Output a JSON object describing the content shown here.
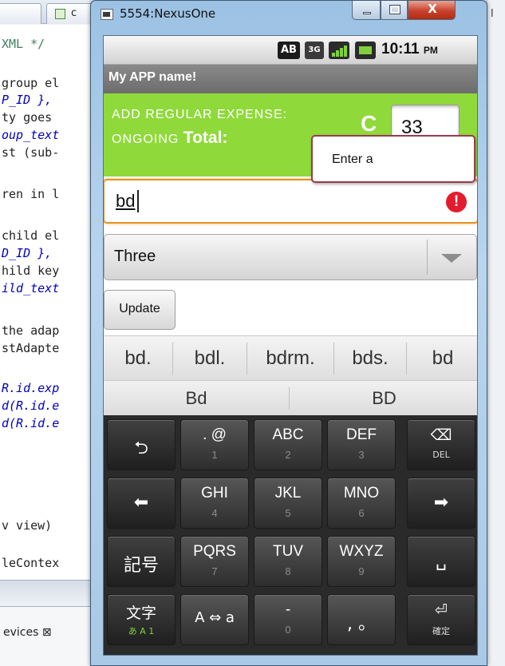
{
  "ide": {
    "tab_label": "c",
    "right_label": "l",
    "code_lines": [
      "XML */",
      "group el",
      "P_ID },",
      "ty goes",
      "oup_text",
      "st (sub-",
      "ren in l",
      "child el",
      "D_ID },",
      "hild key",
      "ild_text",
      "the adap",
      "stAdapte",
      "R.id.exp",
      "d(R.id.e",
      "d(R.id.e",
      "v view)",
      "leContex"
    ],
    "views_label": "evices ⊠"
  },
  "emulator": {
    "window_title": "5554:NexusOne",
    "close_glyph": "X"
  },
  "status_bar": {
    "ab_icon": "AB",
    "network_icon": "3G",
    "time": "10:11",
    "ampm": "PM"
  },
  "app": {
    "title": "My APP name!",
    "heading_line1": "ADD  REGULAR  EXPENSE:",
    "heading_line2": "ONGOING",
    "total_label": "Total:",
    "currency_symbol": "C",
    "total_value": "33",
    "error_popup": "Enter a",
    "entry_value": "bd",
    "error_icon": "!",
    "spinner_value": "Three",
    "update_button": "Update"
  },
  "suggestions": {
    "row1": [
      "bd.",
      "bdl.",
      "bdrm.",
      "bds.",
      "bd"
    ],
    "row2": [
      "Bd",
      "BD"
    ]
  },
  "keyboard": {
    "rows": [
      [
        {
          "main": "⮌",
          "sub": ""
        },
        {
          "main": ". @",
          "sub": "1"
        },
        {
          "main": "ABC",
          "sub": "2"
        },
        {
          "main": "DEF",
          "sub": "3"
        },
        {
          "main": "⌫",
          "sub": "DEL"
        }
      ],
      [
        {
          "main": "⬅",
          "sub": ""
        },
        {
          "main": "GHI",
          "sub": "4"
        },
        {
          "main": "JKL",
          "sub": "5"
        },
        {
          "main": "MNO",
          "sub": "6"
        },
        {
          "main": "➡",
          "sub": ""
        }
      ],
      [
        {
          "main": "記号",
          "sub": ""
        },
        {
          "main": "PQRS",
          "sub": "7"
        },
        {
          "main": "TUV",
          "sub": "8"
        },
        {
          "main": "WXYZ",
          "sub": "9"
        },
        {
          "main": "␣",
          "sub": ""
        }
      ],
      [
        {
          "main": "文字",
          "sub": "あ A 1"
        },
        {
          "main": "A ⇔ a",
          "sub": ""
        },
        {
          "main": "-",
          "sub": "0"
        },
        {
          "main": ", 。",
          "sub": ""
        },
        {
          "main": "⏎",
          "sub": "確定"
        }
      ]
    ]
  },
  "colors": {
    "header_green": "#8fd93a",
    "focus_orange": "#e39429",
    "error_red": "#e41b2d",
    "signal_green": "#7fd13b"
  }
}
